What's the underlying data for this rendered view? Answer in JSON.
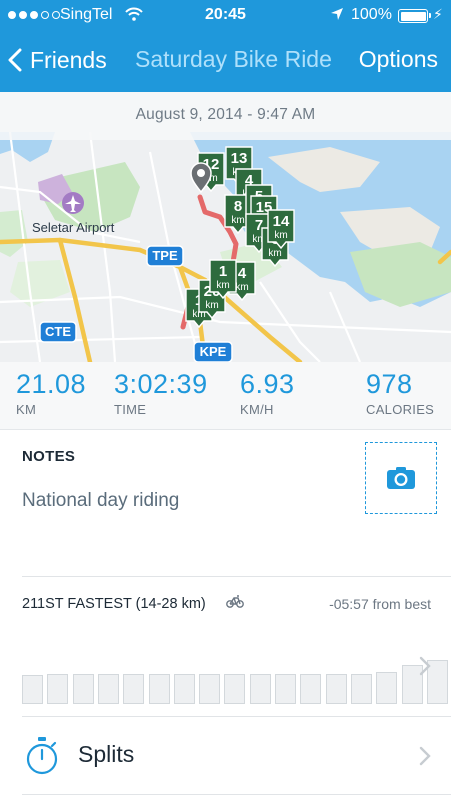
{
  "status_bar": {
    "carrier": "SingTel",
    "time": "20:45",
    "battery": "100%",
    "signal_bars_filled": 3,
    "signal_bars_total": 5
  },
  "nav": {
    "back_label": "Friends",
    "title": "Saturday Bike Ride",
    "options_label": "Options"
  },
  "activity": {
    "date": "August 9, 2014 - 9:47 AM"
  },
  "map": {
    "labels": {
      "airport": "Seletar Airport",
      "tpe": "TPE",
      "cte": "CTE",
      "kpe": "KPE"
    },
    "km_unit": "km",
    "markers": [
      "12",
      "13",
      "4",
      "8",
      "5",
      "15",
      "7",
      "6",
      "14",
      "1",
      "4",
      "20",
      "1"
    ]
  },
  "stats": [
    {
      "value": "21.08",
      "label": "KM"
    },
    {
      "value": "3:02:39",
      "label": "TIME"
    },
    {
      "value": "6.93",
      "label": "KM/H"
    },
    {
      "value": "978",
      "label": "CALORIES"
    }
  ],
  "notes": {
    "heading": "NOTES",
    "text": "National day riding"
  },
  "segment": {
    "title": "211ST FASTEST (14-28 km)",
    "best": "-05:57 from best",
    "bar_levels": [
      0.35,
      0.36,
      0.36,
      0.36,
      0.36,
      0.36,
      0.36,
      0.36,
      0.36,
      0.36,
      0.36,
      0.36,
      0.36,
      0.36,
      0.38,
      0.47,
      0.52,
      1.0
    ],
    "highlight_index": 17
  },
  "splits": {
    "label": "Splits"
  },
  "colors": {
    "accent": "#1f98db",
    "green": "#2ecc5a",
    "marker_green": "#2e6b3e",
    "route_red": "#e46a6a"
  },
  "icons": [
    "back-chevron-icon",
    "wifi-icon",
    "location-arrow-icon",
    "battery-icon",
    "camera-icon",
    "bike-icon",
    "stopwatch-icon",
    "chevron-right-icon",
    "airplane-icon",
    "map-pin-icon"
  ]
}
